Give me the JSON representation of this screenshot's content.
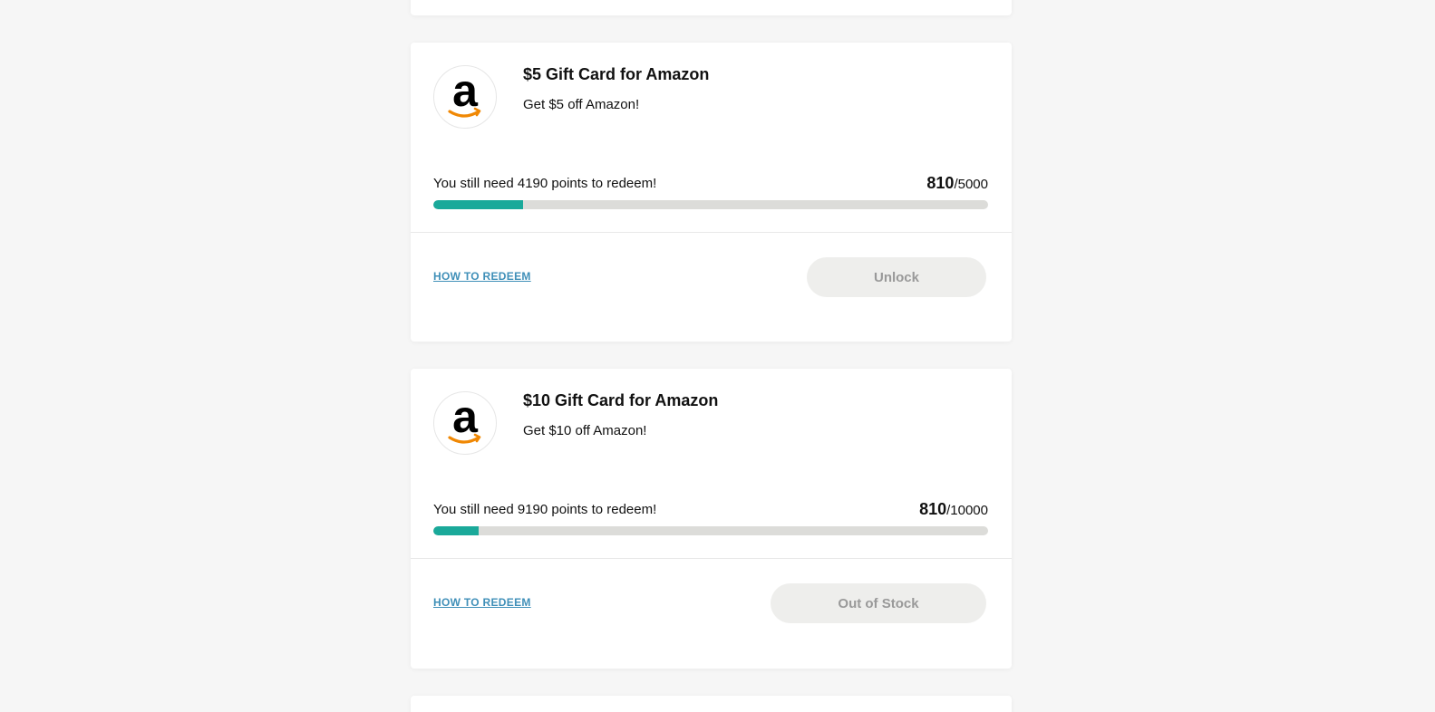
{
  "colors": {
    "progress_fill": "#1aa99a",
    "progress_track": "#dcdcd9",
    "link": "#3f8fb8",
    "button_bg": "#eeeeec",
    "button_text": "#999999"
  },
  "rewards": [
    {
      "logo_icon": "amazon-logo-icon",
      "title": "$5 Gift Card for Amazon",
      "subtitle": "Get $5 off Amazon!",
      "need_text": "You still need 4190 points to redeem!",
      "current_points": "810",
      "separator": "/",
      "goal_points": "5000",
      "progress_fraction": 0.162,
      "how_to_redeem": "HOW TO REDEEM",
      "action_label": "Unlock"
    },
    {
      "logo_icon": "amazon-logo-icon",
      "title": "$10 Gift Card for Amazon",
      "subtitle": "Get $10 off Amazon!",
      "need_text": "You still need 9190 points to redeem!",
      "current_points": "810",
      "separator": "/",
      "goal_points": "10000",
      "progress_fraction": 0.081,
      "how_to_redeem": "HOW TO REDEEM",
      "action_label": "Out of Stock"
    }
  ]
}
